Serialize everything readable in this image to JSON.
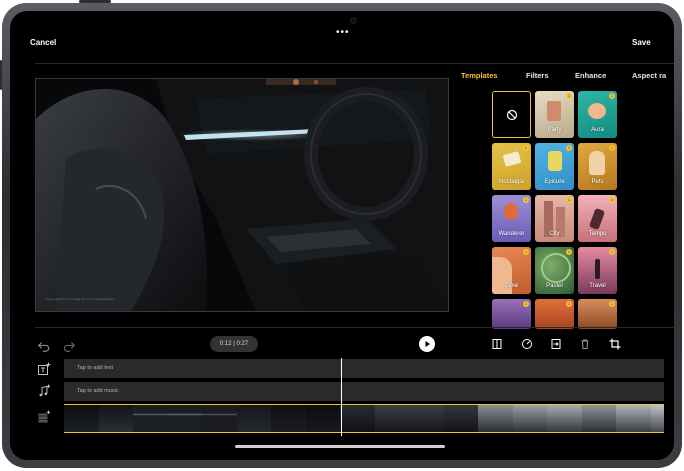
{
  "header": {
    "cancel_label": "Cancel",
    "save_label": "Save",
    "more_label": "•••"
  },
  "preview": {
    "caption": "This product is not for sale but not for demonstration."
  },
  "tabs": [
    {
      "label": "Templates",
      "active": true
    },
    {
      "label": "Filters",
      "active": false
    },
    {
      "label": "Enhance",
      "active": false
    },
    {
      "label": "Aspect ra",
      "active": false
    }
  ],
  "templates": [
    {
      "label": "",
      "icon": "no-template-icon"
    },
    {
      "label": "Party"
    },
    {
      "label": "Aura"
    },
    {
      "label": "Nostalgia"
    },
    {
      "label": "Epicure"
    },
    {
      "label": "Pets"
    },
    {
      "label": "Wanderer"
    },
    {
      "label": "City"
    },
    {
      "label": "Tempo"
    },
    {
      "label": "Time"
    },
    {
      "label": "Pastel"
    },
    {
      "label": "Travel"
    },
    {
      "label": ""
    },
    {
      "label": ""
    },
    {
      "label": ""
    }
  ],
  "playback": {
    "time": "0:12 | 0:27"
  },
  "tracks": {
    "text_placeholder": "Tap to add text",
    "music_placeholder": "Tap to add music"
  },
  "colors": {
    "accent": "#f2c230",
    "background": "#000000"
  }
}
